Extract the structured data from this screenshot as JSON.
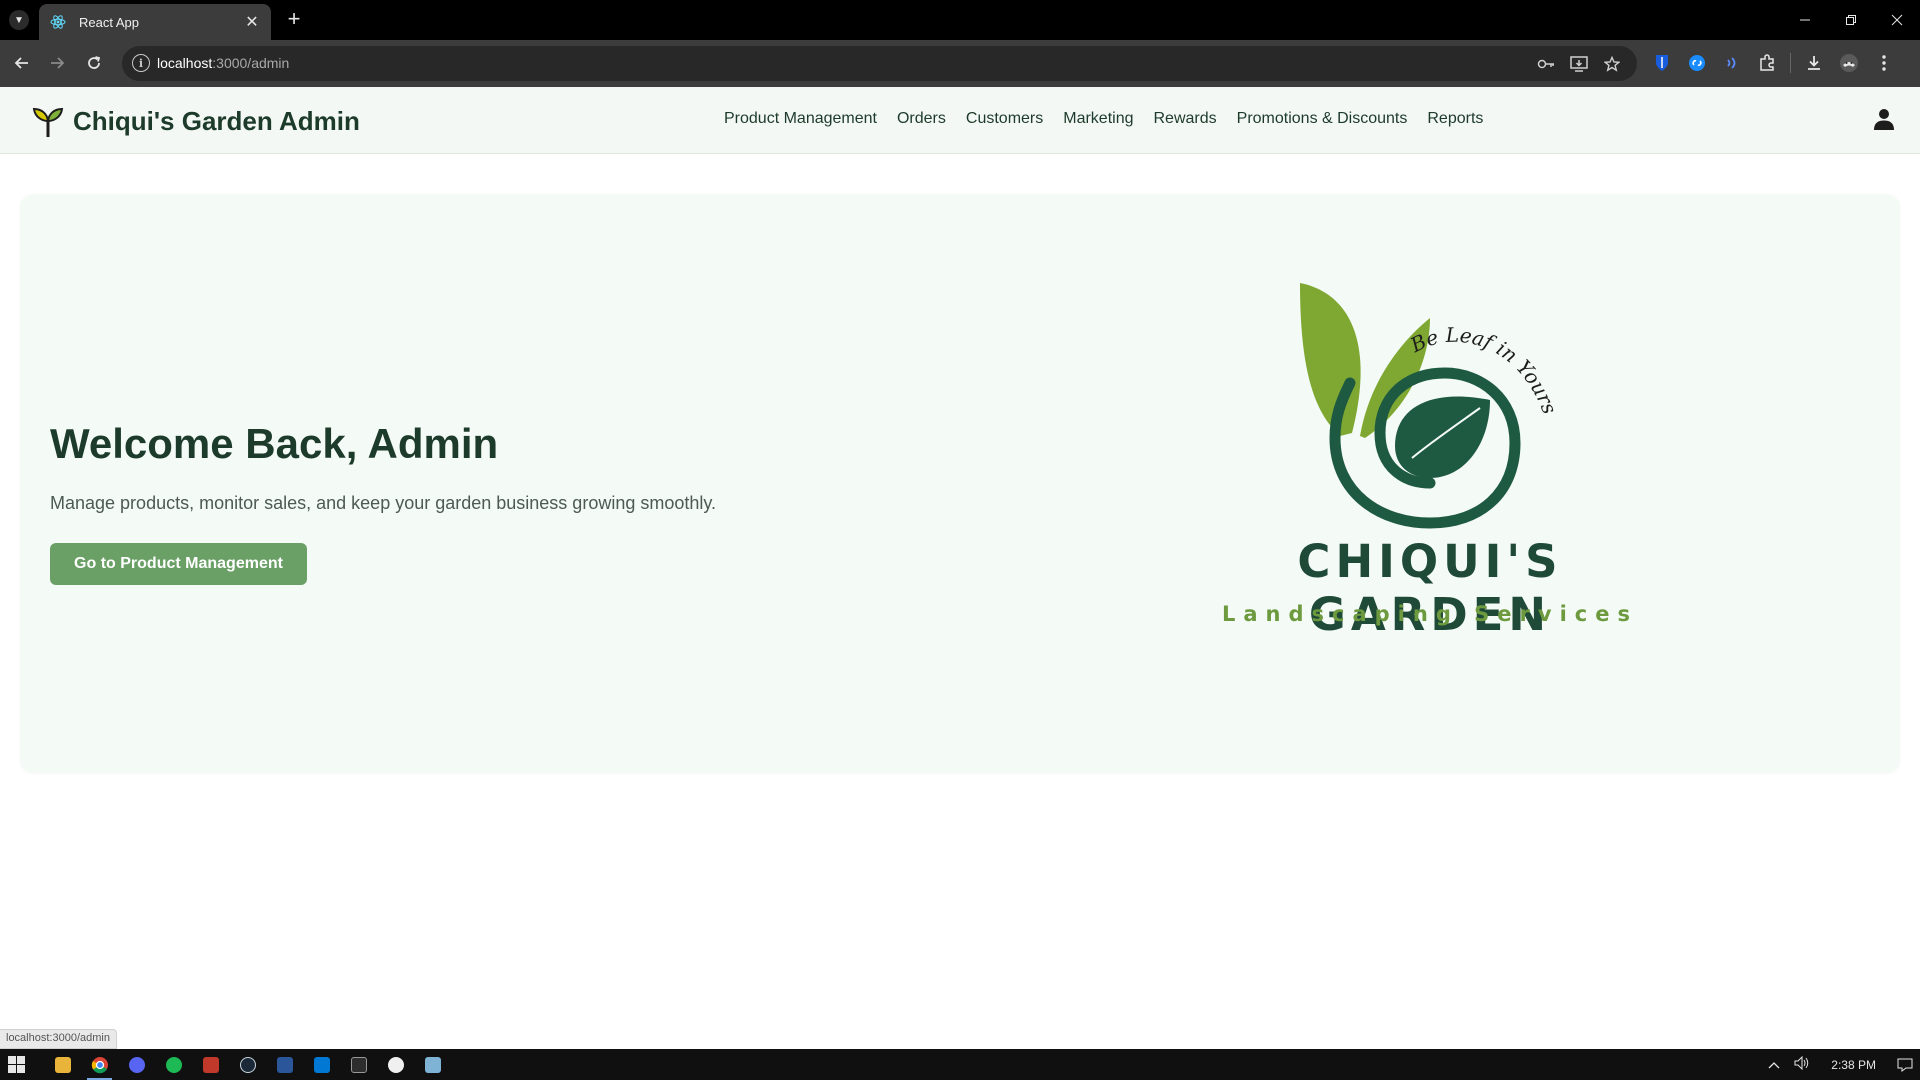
{
  "browser": {
    "tab_title": "React App",
    "tab_close": "✕",
    "new_tab": "+",
    "url_host": "localhost",
    "url_path": ":3000/admin",
    "status_url": "localhost:3000/admin"
  },
  "header": {
    "brand_title": "Chiqui's Garden Admin",
    "nav": [
      "Product Management",
      "Orders",
      "Customers",
      "Marketing",
      "Rewards",
      "Promotions & Discounts",
      "Reports"
    ]
  },
  "hero": {
    "title": "Welcome Back, Admin",
    "subtitle": "Manage products, monitor sales, and keep your garden business growing smoothly.",
    "button_label": "Go to Product Management"
  },
  "logo": {
    "name": "CHIQUI'S GARDEN",
    "subtitle": "Landscaping Services",
    "tagline": "Be Leaf in Yourself"
  },
  "taskbar": {
    "clock": "2:38 PM"
  },
  "colors": {
    "brand_dark": "#1d3b2b",
    "button": "#6aa066",
    "hero_bg": "#f4faf6",
    "leaf_green": "#7fa832",
    "logo_dark": "#1e4a37"
  }
}
